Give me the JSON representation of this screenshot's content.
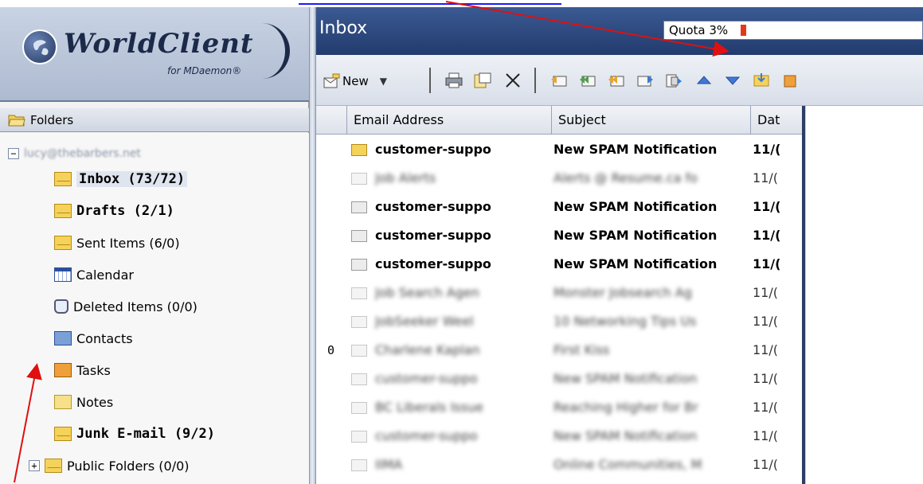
{
  "logo": {
    "name": "WorldClient",
    "sub": "for MDaemon®"
  },
  "folders_header": "Folders",
  "account": "lucy@thebarbers.net",
  "tree": [
    {
      "label": "Inbox (73/72)",
      "icon": "envelope-icon",
      "bold": true,
      "selected": true
    },
    {
      "label": "Drafts (2/1)",
      "icon": "envelope-icon",
      "bold": true
    },
    {
      "label": "Sent Items (6/0)",
      "icon": "envelope-icon"
    },
    {
      "label": "Calendar",
      "icon": "calendar-icon"
    },
    {
      "label": "Deleted Items (0/0)",
      "icon": "trash-icon"
    },
    {
      "label": "Contacts",
      "icon": "contacts-book-icon"
    },
    {
      "label": "Tasks",
      "icon": "tasks-icon"
    },
    {
      "label": "Notes",
      "icon": "notes-icon"
    },
    {
      "label": "Junk E-mail (9/2)",
      "icon": "envelope-icon",
      "bold": true
    },
    {
      "label": "Public Folders (0/0)",
      "icon": "envelope-icon",
      "expander": "+"
    }
  ],
  "inbox": {
    "title": "Inbox",
    "quota_label": "Quota 3%",
    "quota_fraction": 0.03,
    "new_label": "New",
    "columns": [
      "Email Address",
      "Subject",
      "Dat"
    ]
  },
  "messages": [
    {
      "from": "customer-suppo",
      "subject": "New SPAM Notification",
      "date": "11/(",
      "unread": true,
      "new": true
    },
    {
      "from": "Job Alerts",
      "subject": "Alerts @ Resume.ca fo",
      "date": "11/(",
      "blur": true
    },
    {
      "from": "customer-suppo",
      "subject": "New SPAM Notification",
      "date": "11/(",
      "unread": true
    },
    {
      "from": "customer-suppo",
      "subject": "New SPAM Notification",
      "date": "11/(",
      "unread": true
    },
    {
      "from": "customer-suppo",
      "subject": "New SPAM Notification",
      "date": "11/(",
      "unread": true
    },
    {
      "from": "Job Search Agen",
      "subject": "Monster Jobsearch Ag",
      "date": "11/(",
      "blur": true
    },
    {
      "from": "JobSeeker Weel",
      "subject": "10 Networking Tips Us",
      "date": "11/(",
      "blur": true
    },
    {
      "from": "Charlene Kaplan",
      "subject": "First Kiss",
      "date": "11/(",
      "blur": true,
      "attach": "0"
    },
    {
      "from": "customer-suppo",
      "subject": "New SPAM Notification",
      "date": "11/(",
      "blur": true
    },
    {
      "from": "BC Liberals Issue",
      "subject": "Reaching Higher for Br",
      "date": "11/(",
      "blur": true
    },
    {
      "from": "customer-suppo",
      "subject": "New SPAM Notification",
      "date": "11/(",
      "blur": true
    },
    {
      "from": "IIMA",
      "subject": "Online Communities, M",
      "date": "11/(",
      "blur": true
    }
  ],
  "colors": {
    "title_bar": "#223b6d",
    "quota_bar": "#e23a18",
    "arrow": "#e01010"
  }
}
